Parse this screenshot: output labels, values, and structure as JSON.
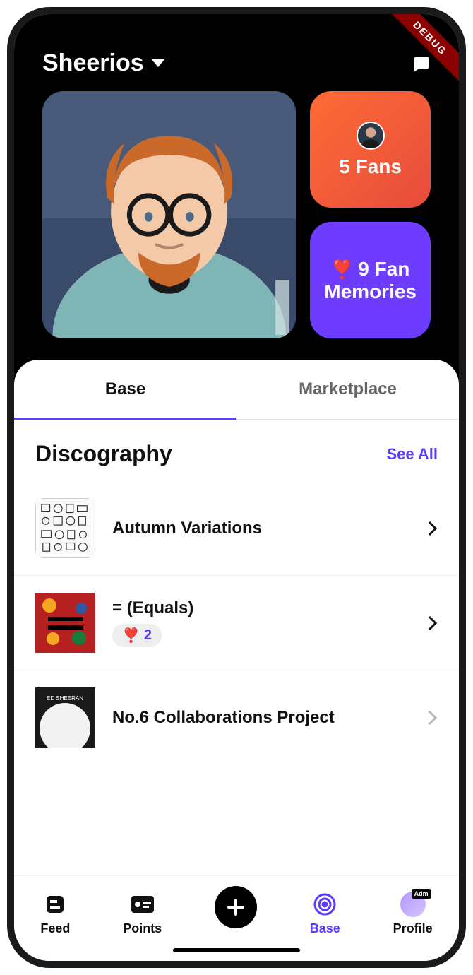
{
  "debug_label": "DEBUG",
  "header": {
    "title": "Sheerios"
  },
  "stats": {
    "fans_label": "5 Fans",
    "memories_label": "9 Fan Memories"
  },
  "tabs": {
    "base": "Base",
    "marketplace": "Marketplace"
  },
  "discography": {
    "title": "Discography",
    "see_all": "See All",
    "items": [
      {
        "title": "Autumn Variations",
        "pinned_count": null
      },
      {
        "title": "= (Equals)",
        "pinned_count": "2"
      },
      {
        "title": "No.6 Collaborations Project",
        "pinned_count": null
      }
    ]
  },
  "nav": {
    "feed": "Feed",
    "points": "Points",
    "base": "Base",
    "profile": "Profile",
    "admin_badge": "Adm"
  }
}
